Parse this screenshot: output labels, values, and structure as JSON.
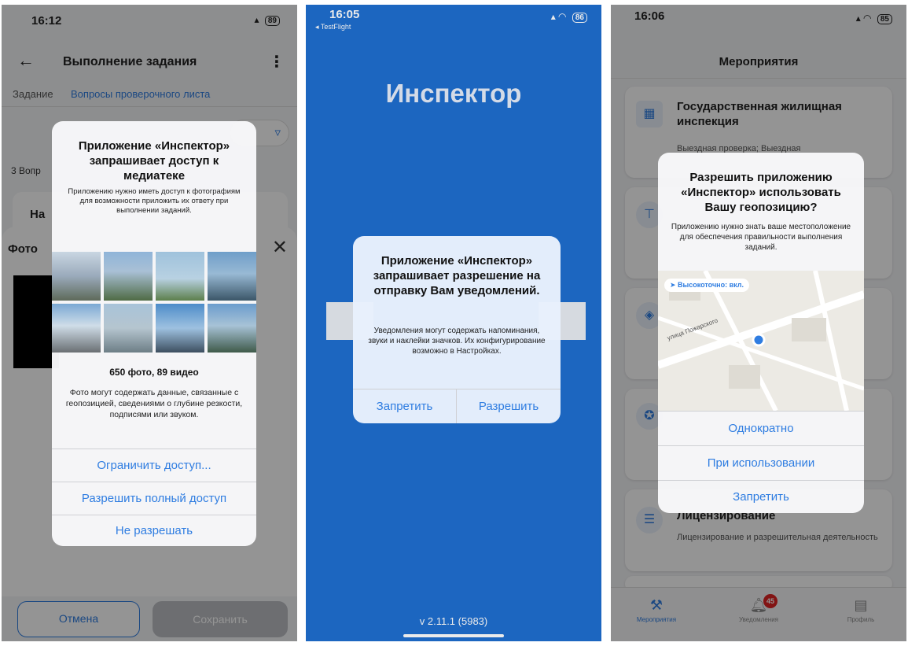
{
  "screen1": {
    "status_time": "16:12",
    "header_title": "Выполнение задания",
    "back_icon": "arrow-left-icon",
    "tab_task": "Задание",
    "tab_questions": "Вопросы проверочного листа",
    "questions_count": "3 Вопр",
    "card_label": "На",
    "sheet_title": "Фото",
    "cancel_label": "Отмена",
    "save_label": "Сохранить",
    "alert": {
      "title": "Приложение «Инспектор» запрашивает доступ к медиатеке",
      "message": "Приложению нужно иметь доступ к фотографиям для возможности приложить их ответу при выполнении заданий.",
      "count": "650 фото, 89 видео",
      "note": "Фото могут содержать данные, связанные с геопозицией, сведениями о глубине резкости, подписями или звуком.",
      "limit": "Ограничить доступ...",
      "full": "Разрешить полный доступ",
      "deny": "Не разрешать"
    }
  },
  "screen2": {
    "status_time": "16:05",
    "back_app": "◂ TestFlight",
    "battery": "86",
    "app_title": "Инспектор",
    "version": "v 2.11.1 (5983)",
    "alert": {
      "title": "Приложение «Инспектор» запрашивает разрешение на отправку Вам уведомлений.",
      "message": "Уведомления могут содержать напоминания, звуки и наклейки значков. Их конфигурирование возможно в Настройках.",
      "deny": "Запретить",
      "allow": "Разрешить"
    }
  },
  "screen3": {
    "status_time": "16:06",
    "header_title": "Мероприятия",
    "cards": [
      {
        "title": "Государственная жилищная инспекция",
        "subtitle": "Выездная проверка; Выездная"
      },
      {
        "title": "Лицензирование",
        "subtitle": "Лицензирование и разрешительная деятельность"
      }
    ],
    "alert": {
      "title": "Разрешить приложению «Инспектор» использовать Вашу геопозицию?",
      "message": "Приложению нужно знать ваше местоположение для обеспечения правильности выполнения заданий.",
      "precise": "Высокоточно: вкл.",
      "street": "улица Пожарского",
      "once": "Однократно",
      "while_using": "При использовании",
      "deny": "Запретить"
    },
    "tabs": {
      "events": "Мероприятия",
      "notifications": "Уведомления",
      "badge": "45",
      "profile": "Профиль"
    }
  }
}
